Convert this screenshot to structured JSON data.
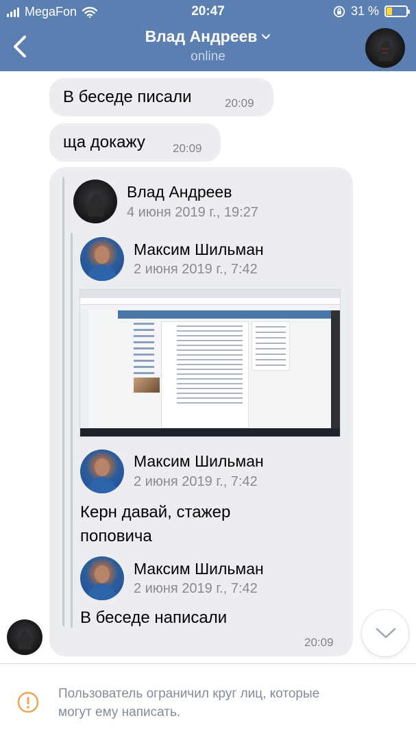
{
  "status_bar": {
    "carrier": "MegaFon",
    "time": "20:47",
    "battery": "31 %",
    "icons": [
      "signal-icon",
      "wifi-icon",
      "rotation-lock-icon",
      "battery-icon"
    ],
    "battery_fill_color": "#ffd83a"
  },
  "header": {
    "name": "Влад Андреев",
    "status": "online",
    "background_color": "#5b7fb0"
  },
  "messages": [
    {
      "text": "В беседе писали",
      "time": "20:09"
    },
    {
      "text": "ща докажу",
      "time": "20:09"
    }
  ],
  "forwarded_message": {
    "time": "20:09",
    "author": {
      "name": "Влад Андреев",
      "date": "4 июня 2019 г., 19:27"
    },
    "nested": [
      {
        "name": "Максим Шильман",
        "date": "2 июня 2019 г., 7:42",
        "attachment": "screenshot"
      },
      {
        "name": "Максим Шильман",
        "date": "2 июня 2019 г., 7:42",
        "text_line1": "Керн давай, стажер",
        "text_line2": "поповича"
      },
      {
        "name": "Максим Шильман",
        "date": "2 июня 2019 г., 7:42",
        "text": "В беседе написали"
      }
    ]
  },
  "footer": {
    "notice_line1": "Пользователь ограничил круг лиц, которые",
    "notice_line2": "могут ему написать."
  },
  "colors": {
    "bubble": "#ebedf0",
    "muted_text": "#828282",
    "notice_text": "#818c99",
    "warning": "#f0a050"
  }
}
